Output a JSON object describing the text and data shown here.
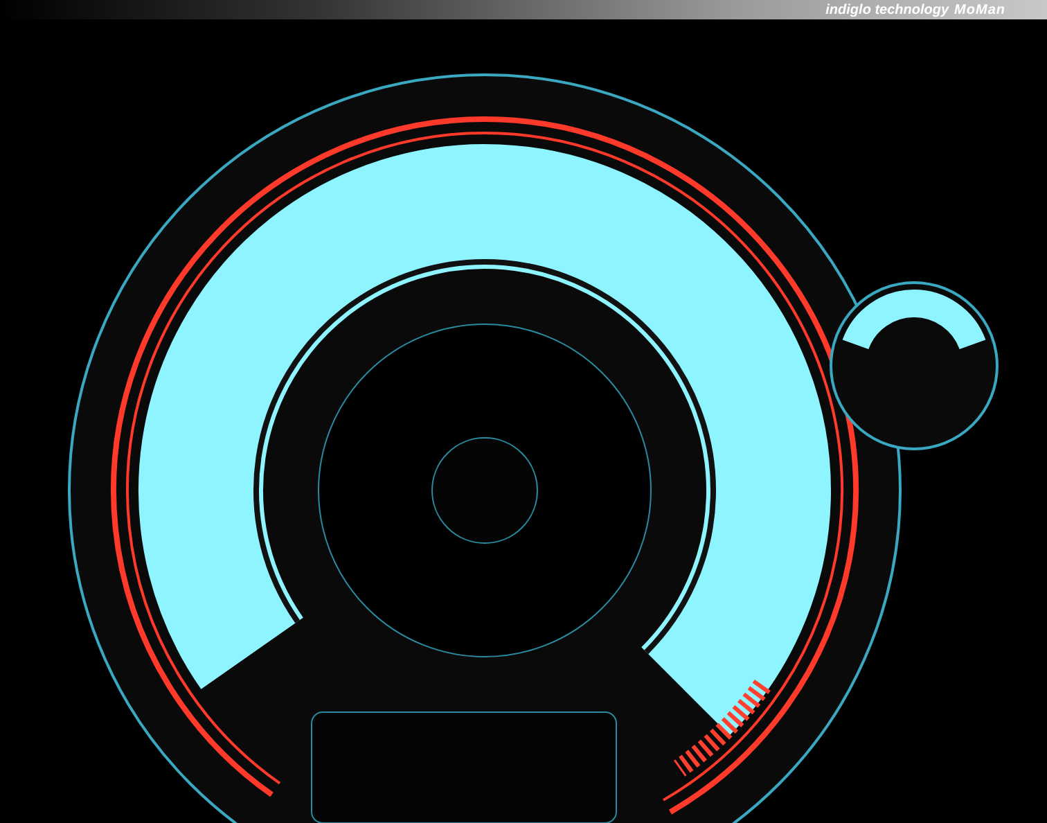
{
  "banner": {
    "text": "indiglo technology",
    "brand": "MoMan"
  }
}
